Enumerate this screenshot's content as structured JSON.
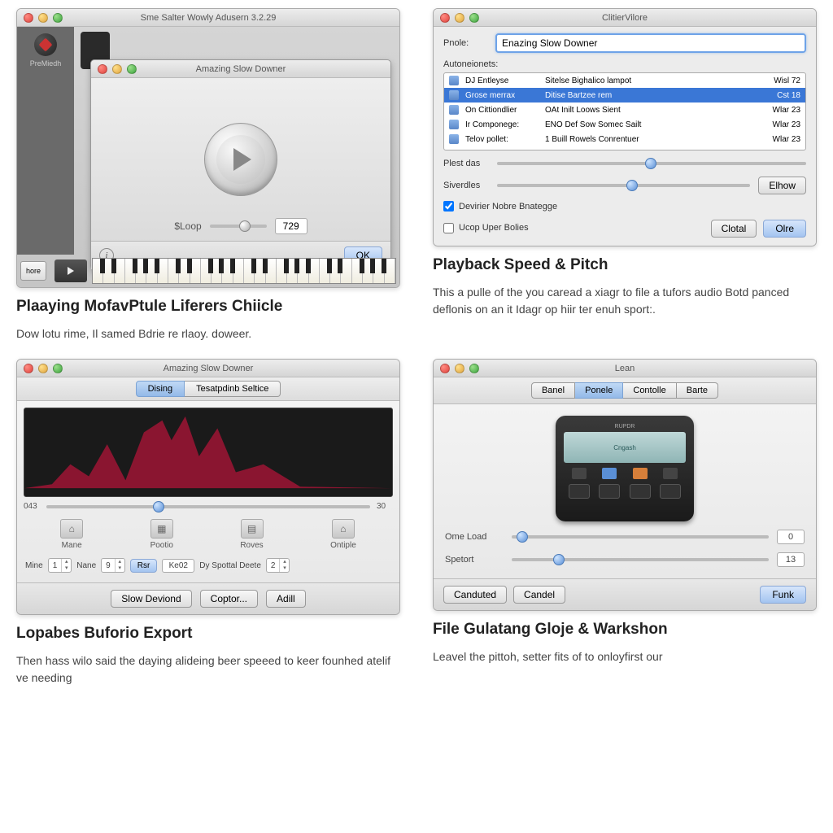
{
  "panel1": {
    "outer_title": "Sme Salter Wowly Adusern 3.2.29",
    "side_label": "PreMiedh",
    "inner_title": "Amazing Slow Downer",
    "loop_label": "$Loop",
    "loop_value": "729",
    "ok_button": "OK",
    "bottom_tiny": "hore",
    "heading": "Plaaying MofavPtule Liferers Chiicle",
    "desc": "Dow lotu rime, Il samed Bdrie re rlaoy. doweer."
  },
  "panel2": {
    "title": "ClitierVilore",
    "profile_label": "Pnole:",
    "profile_value": "Enazing Slow Downer",
    "list_label": "Autoneionets:",
    "items": [
      {
        "c1": "DJ Entleyse",
        "c2": "Sitelse Bighalico lampot",
        "c3": "Wisl 72"
      },
      {
        "c1": "Grose merrax",
        "c2": "Ditise Bartzee rem",
        "c3": "Cst 18"
      },
      {
        "c1": "On Cittiondlier",
        "c2": "OAt Inilt Loows Sient",
        "c3": "Wlar 23"
      },
      {
        "c1": "Ir Componege:",
        "c2": "ENO Def Sow Somec Sailt",
        "c3": "Wlar 23"
      },
      {
        "c1": "Telov pollet:",
        "c2": "1 Buill Rowels Conrentuer",
        "c3": "Wlar 23"
      }
    ],
    "slider1_label": "Plest das",
    "slider2_label": "Siverdles",
    "show_button": "Elhow",
    "check1": "Devirier Nobre Bnategge",
    "check2": "Ucop Uper Bolies",
    "cancel_button": "Clotal",
    "ok_button": "Olre",
    "heading": "Playback Speed & Pitch",
    "desc": "This a pulle of the you caread a xiagr to file a tufors audio Botd panced deflonis on an it Idagr op hiir ter enuh sport:."
  },
  "panel3": {
    "title": "Amazing Slow Downer",
    "tab1": "Dising",
    "tab2": "Tesatpdinb Seltice",
    "wave_left": "043",
    "wave_right": "30",
    "icons": [
      {
        "label": "Mane",
        "glyph": "⌂"
      },
      {
        "label": "Pootio",
        "glyph": "▦"
      },
      {
        "label": "Roves",
        "glyph": "▤"
      },
      {
        "label": "Ontiple",
        "glyph": "⌂"
      }
    ],
    "row_labels": {
      "mne": "Mine",
      "nane": "Nane",
      "rsr": "Rsr",
      "rval": "Ke02",
      "spot": "Dy Spottal Deete"
    },
    "row_values": {
      "mne": "1",
      "nane": "9",
      "spot": "2"
    },
    "footer1": "Slow Deviond",
    "footer2": "Coptor...",
    "footer3": "Adill",
    "heading": "Lopabes Buforio Export",
    "desc": "Then hass wilo said the daying alideing beer speeed to keer founhed atelif ve needing"
  },
  "panel4": {
    "title": "Lean",
    "tabs": [
      "Banel",
      "Ponele",
      "Contolle",
      "Barte"
    ],
    "device_brand": "RUPDR",
    "device_screen": "Cngash",
    "slider1_label": "Ome Load",
    "slider1_value": "0",
    "slider2_label": "Spetort",
    "slider2_value": "13",
    "left1": "Canduted",
    "left2": "Candel",
    "right": "Funk",
    "heading": "File Gulatang Gloje & Warkshon",
    "desc": "Leavel the pittoh, setter fits of to onloyfirst our"
  }
}
